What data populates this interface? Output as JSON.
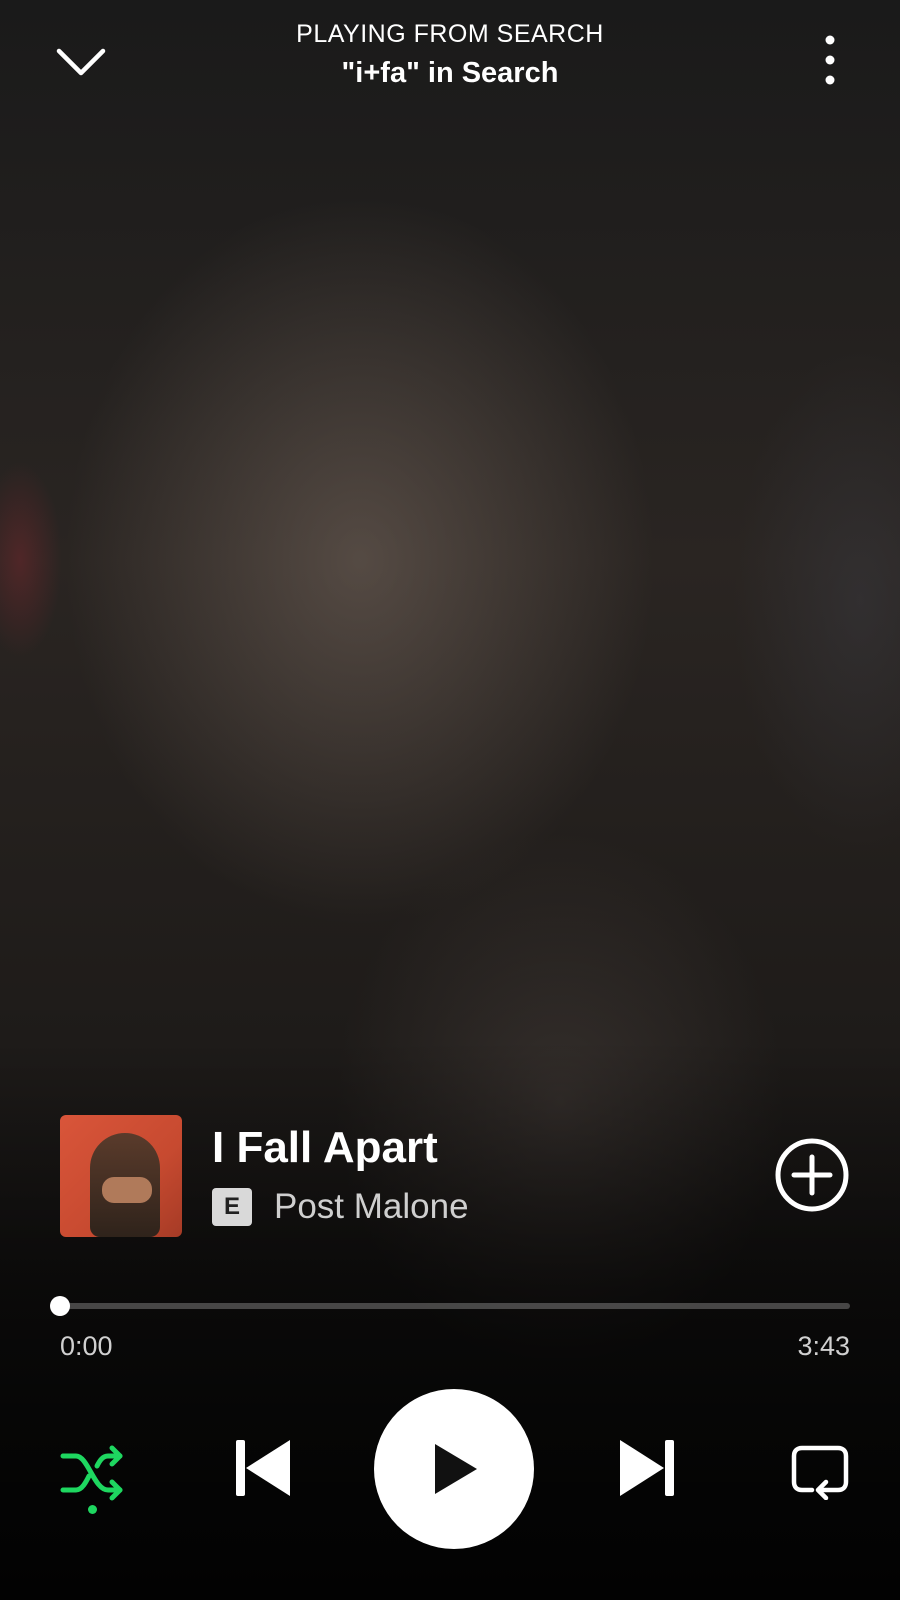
{
  "header": {
    "context_label": "PLAYING FROM SEARCH",
    "context_title": "\"i+fa\" in Search",
    "collapse_icon": "chevron-down-icon",
    "menu_icon": "more-vertical-icon"
  },
  "track": {
    "title": "I Fall Apart",
    "artist": "Post Malone",
    "explicit_badge": "E",
    "add_icon": "plus-circle-icon"
  },
  "playback": {
    "elapsed": "0:00",
    "duration": "3:43",
    "progress_fraction": 0.0
  },
  "controls": {
    "shuffle_icon": "shuffle-icon",
    "shuffle_active": true,
    "previous_icon": "skip-previous-icon",
    "play_icon": "play-icon",
    "next_icon": "skip-next-icon",
    "repeat_icon": "repeat-icon"
  },
  "colors": {
    "accent": "#1ed760",
    "text": "#ffffff",
    "secondary_text": "#cfcfcf"
  }
}
